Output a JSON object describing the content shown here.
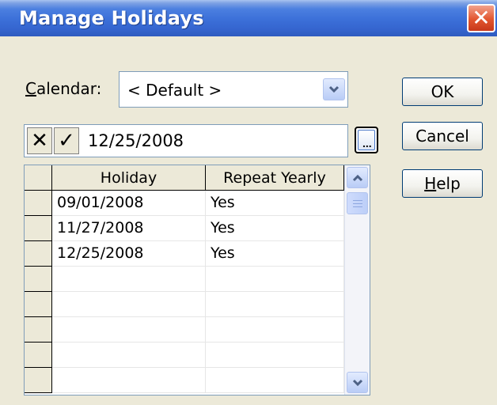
{
  "window": {
    "title": "Manage Holidays",
    "close_label": "✕"
  },
  "calendar": {
    "label_prefix": "",
    "label_mnemonic": "C",
    "label_rest": "alendar:",
    "selected": "< Default >"
  },
  "edit_bar": {
    "cancel_glyph": "✕",
    "accept_glyph": "✓",
    "value": "12/25/2008"
  },
  "buttons": {
    "ok": "OK",
    "cancel": "Cancel",
    "help_mnemonic": "H",
    "help_rest": "elp"
  },
  "grid": {
    "columns": [
      "Holiday",
      "Repeat Yearly"
    ],
    "rows": [
      [
        "09/01/2008",
        "Yes"
      ],
      [
        "11/27/2008",
        "Yes"
      ],
      [
        "12/25/2008",
        "Yes"
      ],
      [
        "",
        ""
      ],
      [
        "",
        ""
      ],
      [
        "",
        ""
      ],
      [
        "",
        ""
      ],
      [
        "",
        ""
      ]
    ]
  },
  "colors": {
    "titlebar": "#3b6fd8",
    "dialog_bg": "#ece9d8",
    "close_button": "#e2562f",
    "scroll_arrow": "#4d6185"
  }
}
